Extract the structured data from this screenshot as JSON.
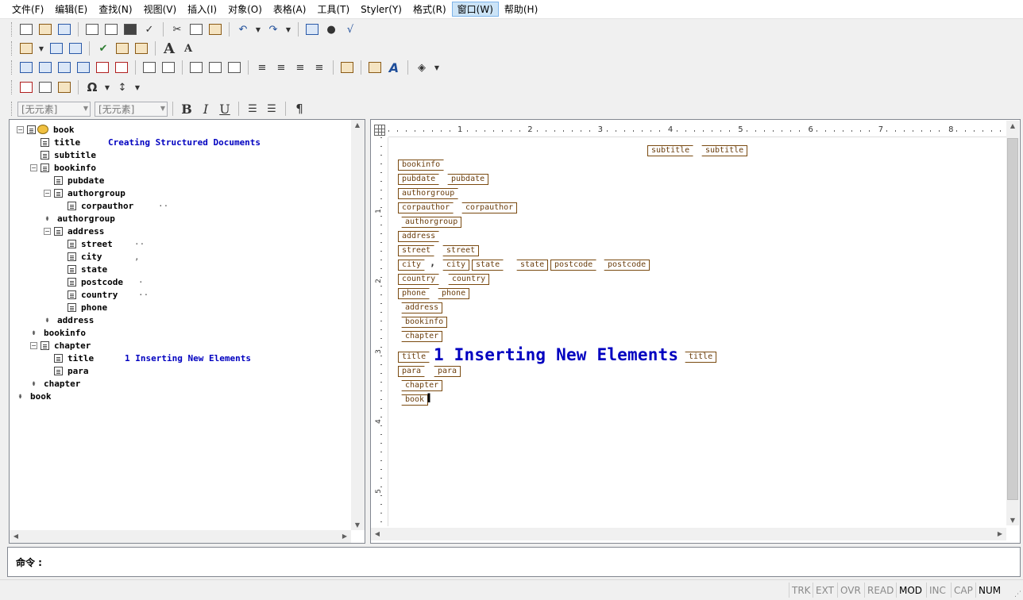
{
  "menu": [
    "文件(F)",
    "编辑(E)",
    "查找(N)",
    "视图(V)",
    "插入(I)",
    "对象(O)",
    "表格(A)",
    "工具(T)",
    "Styler(Y)",
    "格式(R)",
    "窗口(W)",
    "帮助(H)"
  ],
  "active_menu_index": 10,
  "format_bar": {
    "element_combo": "[无元素]",
    "style_combo": "[无元素]",
    "bold": "B",
    "italic": "I",
    "underline": "U",
    "pilcrow": "¶"
  },
  "font_buttons": {
    "big_a": "A",
    "small_a": "A"
  },
  "tree": [
    {
      "label": "book",
      "value": "",
      "toggle": "⊟"
    },
    {
      "label": "title",
      "value": "Creating Structured Documents",
      "toggle": ""
    },
    {
      "label": "subtitle",
      "value": "",
      "toggle": ""
    },
    {
      "label": "bookinfo",
      "value": "",
      "toggle": "⊟"
    },
    {
      "label": "pubdate",
      "value": "",
      "toggle": ""
    },
    {
      "label": "authorgroup",
      "value": "",
      "toggle": "⊟"
    },
    {
      "label": "corpauthor",
      "value": "··",
      "toggle": ""
    },
    {
      "label": "authorgroup",
      "value": "",
      "toggle": ""
    },
    {
      "label": "address",
      "value": "",
      "toggle": "⊟"
    },
    {
      "label": "street",
      "value": "··",
      "toggle": ""
    },
    {
      "label": "city",
      "value": ",",
      "toggle": ""
    },
    {
      "label": "state",
      "value": "",
      "toggle": ""
    },
    {
      "label": "postcode",
      "value": "·",
      "toggle": ""
    },
    {
      "label": "country",
      "value": "··",
      "toggle": ""
    },
    {
      "label": "phone",
      "value": "",
      "toggle": ""
    },
    {
      "label": "address",
      "value": "",
      "toggle": ""
    },
    {
      "label": "bookinfo",
      "value": "",
      "toggle": ""
    },
    {
      "label": "chapter",
      "value": "",
      "toggle": "⊟"
    },
    {
      "label": "title",
      "value": "1 Inserting New Elements",
      "toggle": ""
    },
    {
      "label": "para",
      "value": "",
      "toggle": ""
    },
    {
      "label": "chapter",
      "value": "",
      "toggle": ""
    },
    {
      "label": "book",
      "value": "",
      "toggle": ""
    }
  ],
  "ruler": {
    "h_numbers": [
      "1",
      "2",
      "3",
      "4",
      "5",
      "6",
      "7",
      "8"
    ],
    "v_numbers": [
      "1",
      "2",
      "3",
      "4",
      "5"
    ]
  },
  "doc": {
    "tags": [
      "subtitle",
      "subtitle",
      "bookinfo",
      "pubdate",
      "pubdate",
      "authorgroup",
      "corpauthor",
      "corpauthor",
      "authorgroup",
      "address",
      "street",
      "street",
      "city",
      "city",
      "state",
      "state",
      "postcode",
      "postcode",
      "country",
      "country",
      "phone",
      "phone",
      "address",
      "bookinfo",
      "chapter",
      "title",
      "title",
      "para",
      "para",
      "chapter",
      "book"
    ],
    "city_sep": ",",
    "heading": "1 Inserting New Elements"
  },
  "command": {
    "label": "命令 :"
  },
  "status": [
    "TRK",
    "EXT",
    "OVR",
    "READ",
    "MOD",
    "INC",
    "CAP",
    "NUM"
  ],
  "status_active": [
    "MOD",
    "NUM"
  ]
}
